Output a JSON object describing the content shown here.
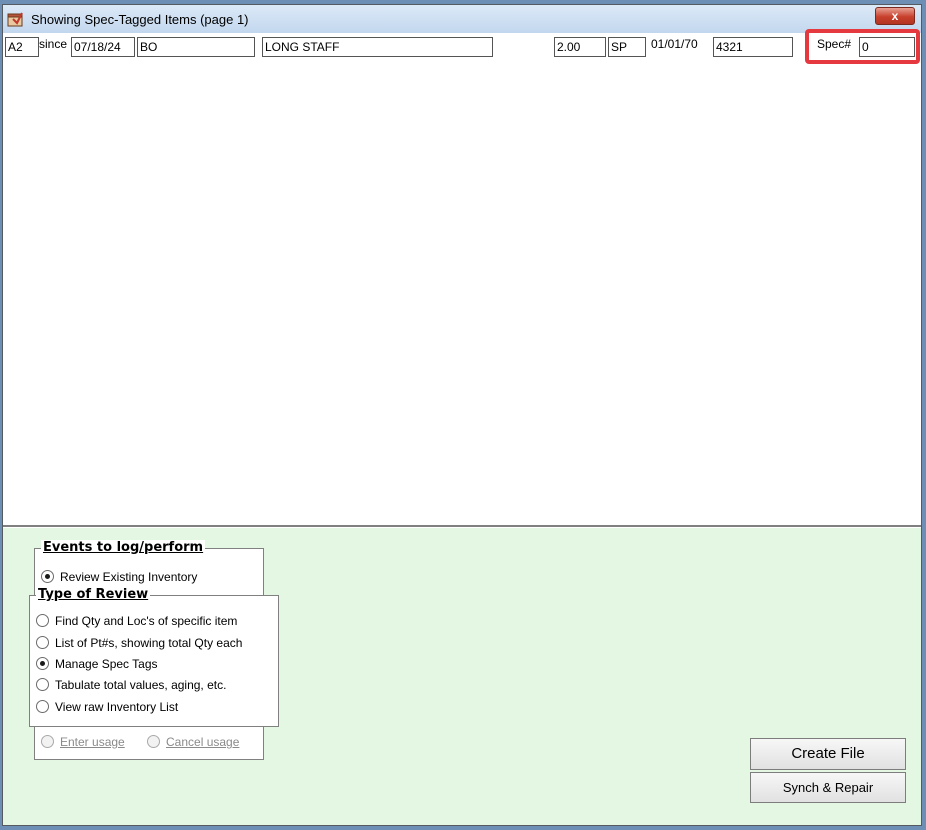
{
  "window": {
    "title": "Showing Spec-Tagged Items (page 1)",
    "close_label": "x"
  },
  "item_row": {
    "loc": "A2",
    "since_label": "since",
    "date": "07/18/24",
    "code": "BO",
    "description": "LONG STAFF",
    "qty": "2.00",
    "unit": "SP",
    "date2": "01/01/70",
    "part_no": "4321",
    "spec_label": "Spec#",
    "spec_value": "0"
  },
  "events_group": {
    "title": "Events to log/perform",
    "review_existing": {
      "label": "Review Existing Inventory",
      "checked": true
    }
  },
  "review_group": {
    "title": "Type of Review",
    "options": [
      {
        "label": "Find Qty and Loc's of specific item",
        "checked": false
      },
      {
        "label": "List of Pt#s, showing total Qty each",
        "checked": false
      },
      {
        "label": "Manage Spec Tags",
        "checked": true
      },
      {
        "label": "Tabulate total values, aging, etc.",
        "checked": false
      },
      {
        "label": "View raw Inventory List",
        "checked": false
      }
    ]
  },
  "usage": {
    "enter_label": "Enter usage",
    "cancel_label": "Cancel usage"
  },
  "buttons": {
    "create_file": "Create File",
    "synch_repair": "Synch & Repair"
  },
  "colors": {
    "bottom_panel_bg": "#e4f7e3",
    "highlight_border": "#e5393f",
    "close_button": "#c7402c"
  }
}
